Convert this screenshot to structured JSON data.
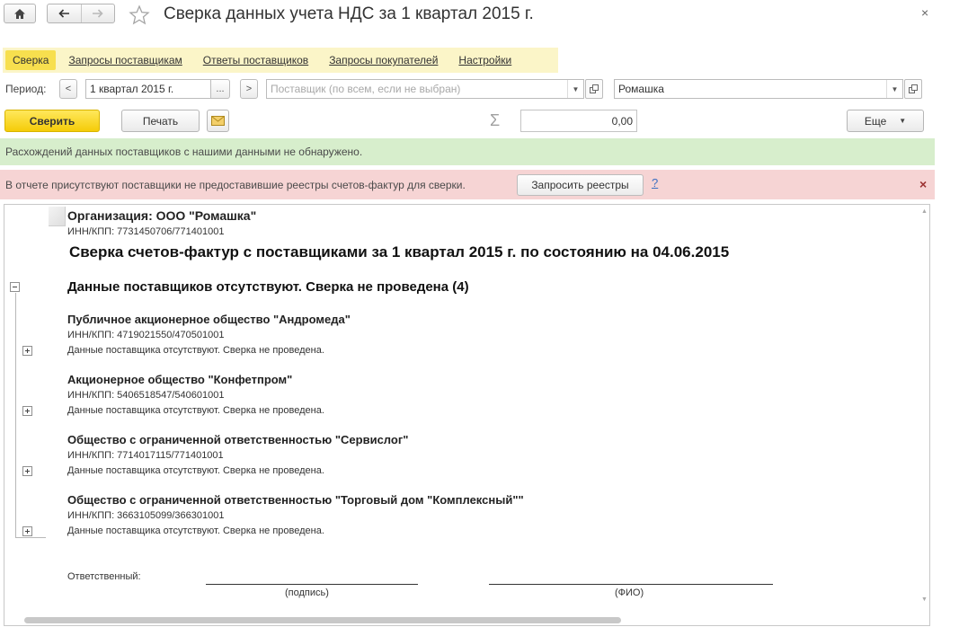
{
  "window": {
    "title": "Сверка данных учета НДС за 1 квартал 2015 г.",
    "close_glyph": "×"
  },
  "tabs": [
    {
      "label": "Сверка",
      "active": true
    },
    {
      "label": "Запросы поставщикам",
      "active": false
    },
    {
      "label": "Ответы поставщиков",
      "active": false
    },
    {
      "label": "Запросы покупателей",
      "active": false
    },
    {
      "label": "Настройки",
      "active": false
    }
  ],
  "filters": {
    "period_label": "Период:",
    "period_value": "1 квартал 2015 г.",
    "prev_glyph": "<",
    "next_glyph": ">",
    "select_glyph": "...",
    "supplier_placeholder": "Поставщик (по всем, если не выбран)",
    "organization_value": "Ромашка"
  },
  "toolbar": {
    "reconcile_label": "Сверить",
    "print_label": "Печать",
    "sigma_glyph": "Σ",
    "sum_value": "0,00",
    "more_label": "Еще"
  },
  "banners": {
    "success_text": "Расхождений данных поставщиков с нашими данными не обнаружено.",
    "warning_text": "В отчете присутствуют поставщики не предоставившие реестры счетов-фактур для сверки.",
    "request_button": "Запросить реестры",
    "help_glyph": "?",
    "close_glyph": "×"
  },
  "report": {
    "org_line": "Организация: ООО \"Ромашка\"",
    "org_inn": "ИНН/КПП: 7731450706/771401001",
    "heading": "Сверка счетов-фактур с поставщиками за 1 квартал 2015 г. по состоянию на 04.06.2015",
    "section_title": "Данные поставщиков отсутствуют. Сверка не проведена (4)",
    "suppliers": [
      {
        "name": "Публичное акционерное общество \"Андромеда\"",
        "inn": "ИНН/КПП: 4719021550/470501001",
        "status": "Данные поставщика отсутствуют. Сверка не проведена."
      },
      {
        "name": "Акционерное общество \"Конфетпром\"",
        "inn": "ИНН/КПП: 5406518547/540601001",
        "status": "Данные поставщика отсутствуют. Сверка не проведена."
      },
      {
        "name": "Общество с ограниченной ответственностью \"Сервислог\"",
        "inn": "ИНН/КПП: 7714017115/771401001",
        "status": "Данные поставщика отсутствуют. Сверка не проведена."
      },
      {
        "name": "Общество с ограниченной ответственностью \"Торговый дом \"Комплексный\"\"",
        "inn": "ИНН/КПП: 3663105099/366301001",
        "status": "Данные поставщика отсутствуют. Сверка не проведена."
      }
    ],
    "responsible_label": "Ответственный:",
    "signature_caption": "(подпись)",
    "fio_caption": "(ФИО)"
  },
  "colors": {
    "accent_yellow": "#f5cc08",
    "tab_bar": "#fbf5c8",
    "success_bg": "#d7eecc",
    "warning_bg": "#f6d4d4",
    "link_blue": "#3b6fc2"
  }
}
